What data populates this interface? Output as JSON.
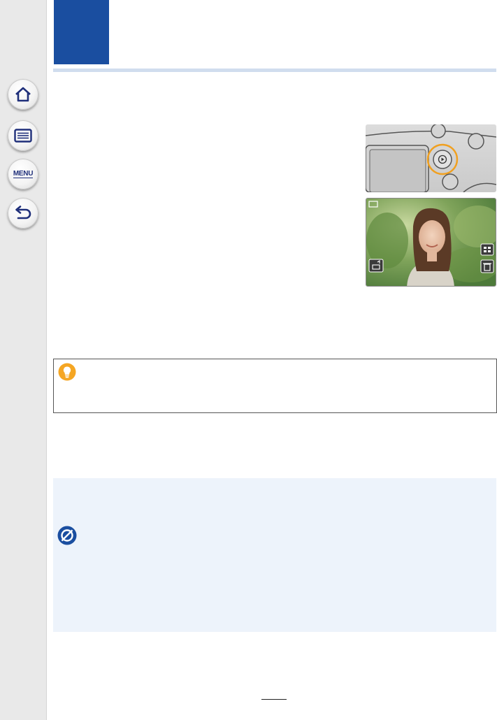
{
  "sidebar": {
    "home_icon": "home-icon",
    "contents_icon": "list-icon",
    "menu_label": "MENU",
    "back_icon": "back-arrow-icon"
  },
  "colors": {
    "chapter_block": "#1a4ea0",
    "header_rule": "#d0ddee",
    "note_background": "#edf3fb",
    "tip_icon": "#f5a623",
    "highlight_ring": "#f0a020",
    "not_available_icon": "#1a4ea0"
  },
  "figures": {
    "camera_button": "camera-rear-playback-button-photo",
    "playback_screen": "playback-screen-photo",
    "playback_icons": [
      "playback-mode-icon",
      "thumbnail-icon",
      "trash-icon",
      "send-image-icon"
    ]
  }
}
